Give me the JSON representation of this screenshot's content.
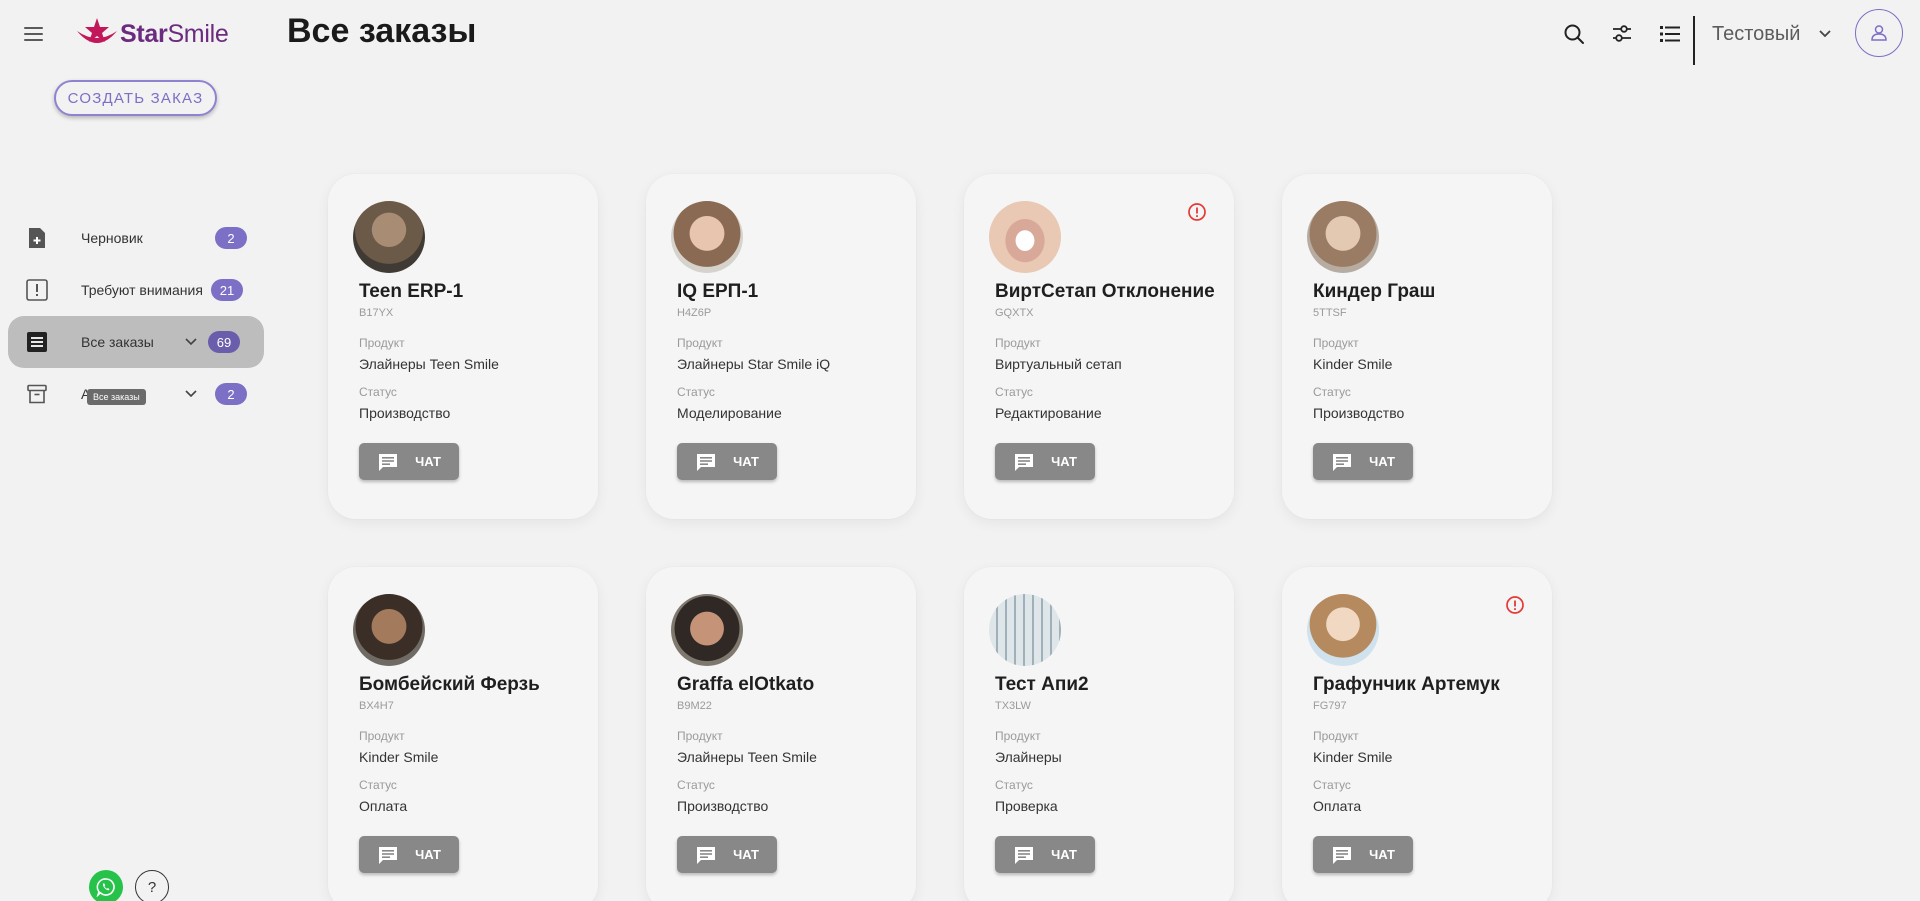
{
  "header": {
    "logo_star": "Star",
    "logo_smile": "Smile",
    "page_title": "Все заказы",
    "user_name": "Тестовый",
    "icons": [
      "search-icon",
      "filter-sliders-icon",
      "list-view-icon",
      "chevron-down-icon",
      "user-icon"
    ]
  },
  "create_order_label": "СОЗДАТЬ ЗАКАЗ",
  "sidebar": {
    "items": [
      {
        "label": "Черновик",
        "count": "2",
        "icon": "file-plus-icon"
      },
      {
        "label": "Требуют внимания",
        "count": "21",
        "icon": "alert-square-icon"
      },
      {
        "label": "Все заказы",
        "count": "69",
        "icon": "list-doc-icon",
        "active": true
      },
      {
        "label": "Архив",
        "count": "2",
        "icon": "archive-icon"
      }
    ],
    "tooltip": "Все заказы"
  },
  "labels": {
    "product": "Продукт",
    "status": "Статус",
    "chat": "ЧАТ"
  },
  "colors": {
    "accent": "#7c6fc6",
    "brand": "#6b2b7f",
    "alert": "#e53935",
    "chat_button": "#888888"
  },
  "orders": [
    {
      "name": "Teen ERP-1",
      "code": "B17YX",
      "product": "Элайнеры Teen Smile",
      "status": "Производство",
      "alert": false
    },
    {
      "name": "IQ ЕРП-1",
      "code": "H4Z6P",
      "product": "Элайнеры Star Smile iQ",
      "status": "Моделирование",
      "alert": false
    },
    {
      "name": "ВиртСетап Отклонение",
      "code": "GQXTX",
      "product": "Виртуальный сетап",
      "status": "Редактирование",
      "alert": true
    },
    {
      "name": "Киндер Граш",
      "code": "5TTSF",
      "product": "Kinder Smile",
      "status": "Производство",
      "alert": false
    },
    {
      "name": "Бомбейский Ферзь",
      "code": "BX4H7",
      "product": "Kinder Smile",
      "status": "Оплата",
      "alert": false
    },
    {
      "name": "Graffa elOtkato",
      "code": "B9M22",
      "product": "Элайнеры Teen Smile",
      "status": "Производство",
      "alert": false
    },
    {
      "name": "Тест Апи2",
      "code": "TX3LW",
      "product": "Элайнеры",
      "status": "Проверка",
      "alert": false
    },
    {
      "name": "Графунчик Артемук",
      "code": "FG797",
      "product": "Kinder Smile",
      "status": "Оплата",
      "alert": true
    }
  ]
}
